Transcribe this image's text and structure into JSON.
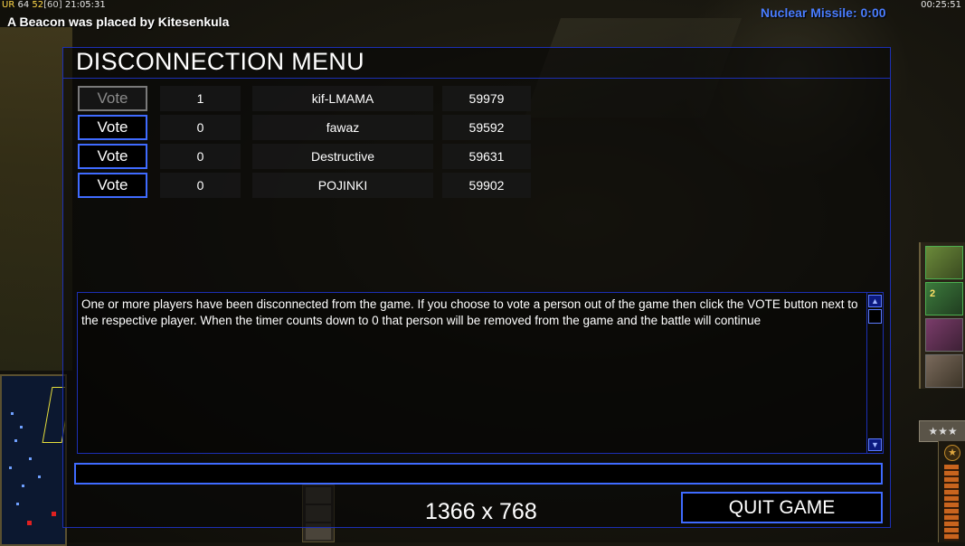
{
  "hud": {
    "stats_ur": "UR",
    "stats_a": "64",
    "stats_b": "52",
    "stats_fps": "[60]",
    "real_clock": "21:05:31",
    "beacon_message": "A Beacon was placed by Kitesenkula",
    "nuclear_timer": "Nuclear Missile: 0:00",
    "game_time": "00:25:51"
  },
  "sidebar": {
    "rank_stars": "★★★",
    "promo_badge": "2"
  },
  "dialog": {
    "title": "DISCONNECTION MENU",
    "vote_label": "Vote",
    "players": [
      {
        "votes": "1",
        "name": "kif-LMAMA",
        "ping": "59979",
        "vote_enabled": false
      },
      {
        "votes": "0",
        "name": "fawaz",
        "ping": "59592",
        "vote_enabled": true
      },
      {
        "votes": "0",
        "name": "Destructive",
        "ping": "59631",
        "vote_enabled": true
      },
      {
        "votes": "0",
        "name": "POJINKI",
        "ping": "59902",
        "vote_enabled": true
      }
    ],
    "message": "One or more players have been disconnected from the game. If you choose to vote a person out of the game then click the VOTE button next to the respective player. When the timer counts down to 0 that person will be removed from the game and the battle will continue",
    "chat_value": "",
    "resolution_label": "1366 x 768",
    "quit_label": "QUIT GAME"
  },
  "colors": {
    "accent_blue": "#3f6bff",
    "frame_blue": "#1c2fb4",
    "nuke_blue": "#4a7dff"
  }
}
